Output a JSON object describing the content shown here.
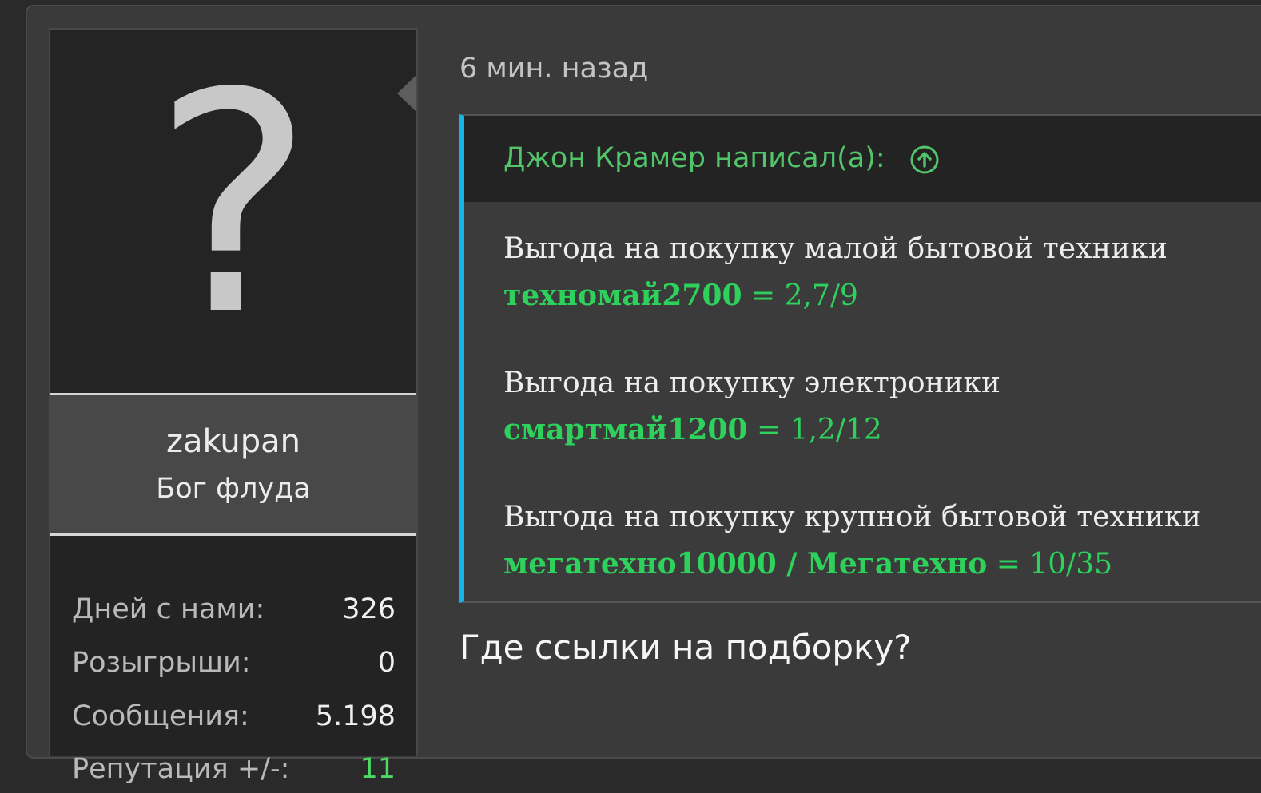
{
  "user": {
    "avatar_glyph": "?",
    "username": "zakupan",
    "title": "Бог флуда",
    "stats": [
      {
        "label": "Дней с нами:",
        "value": "326"
      },
      {
        "label": "Розыгрыши:",
        "value": "0"
      },
      {
        "label": "Сообщения:",
        "value": "5.198"
      },
      {
        "label": "Репутация +/-:",
        "value": "11"
      }
    ]
  },
  "post": {
    "time": "6 мин. назад",
    "quote": {
      "author": "Джон Крамер написал(а):",
      "icon": "arrow-up-circle-icon",
      "deals": [
        {
          "title": "Выгода на покупку малой бытовой техники",
          "code": "техномай2700",
          "value": "= 2,7/9"
        },
        {
          "title": "Выгода на покупку электроники",
          "code": "смартмай1200",
          "value": "= 1,2/12"
        },
        {
          "title": "Выгода на покупку крупной бытовой техники",
          "code": "мегатехно10000 / Мегатехно",
          "value": "= 10/35"
        }
      ]
    },
    "reply": "Где ссылки на подборку?"
  },
  "colors": {
    "accent_green": "#2ed15b",
    "quote_border": "#14b3e8",
    "background": "#3a3a3a"
  }
}
